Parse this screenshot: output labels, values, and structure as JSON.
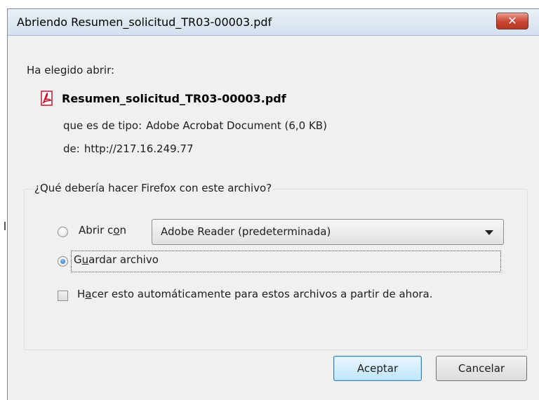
{
  "window": {
    "title": "Abriendo Resumen_solicitud_TR03-00003.pdf",
    "close_glyph": "✕"
  },
  "body": {
    "chosen_label": "Ha elegido abrir:",
    "file_icon": "pdf-icon",
    "file_name": "Resumen_solicitud_TR03-00003.pdf",
    "type_label": "que es de tipo:",
    "type_value": "Adobe Acrobat Document (6,0 KB)",
    "from_label": "de:",
    "from_value": "http://217.16.249.77"
  },
  "action_group": {
    "legend": "¿Qué debería hacer Firefox con este archivo?",
    "open_with": {
      "label_pre": "Abrir c",
      "label_accel": "o",
      "label_post": "n",
      "selected": false,
      "app": "Adobe Reader  (predeterminada)"
    },
    "save_file": {
      "label_pre": "G",
      "label_accel": "u",
      "label_post": "ardar archivo",
      "selected": true
    },
    "auto": {
      "label_pre": "H",
      "label_accel": "a",
      "label_post": "cer esto automáticamente para estos archivos a partir de ahora.",
      "checked": false
    }
  },
  "buttons": {
    "ok": "Aceptar",
    "cancel": "Cancelar"
  },
  "colors": {
    "accent_blue": "#1c63b5",
    "pdf_red": "#c8102e",
    "close_red": "#c9442f"
  }
}
